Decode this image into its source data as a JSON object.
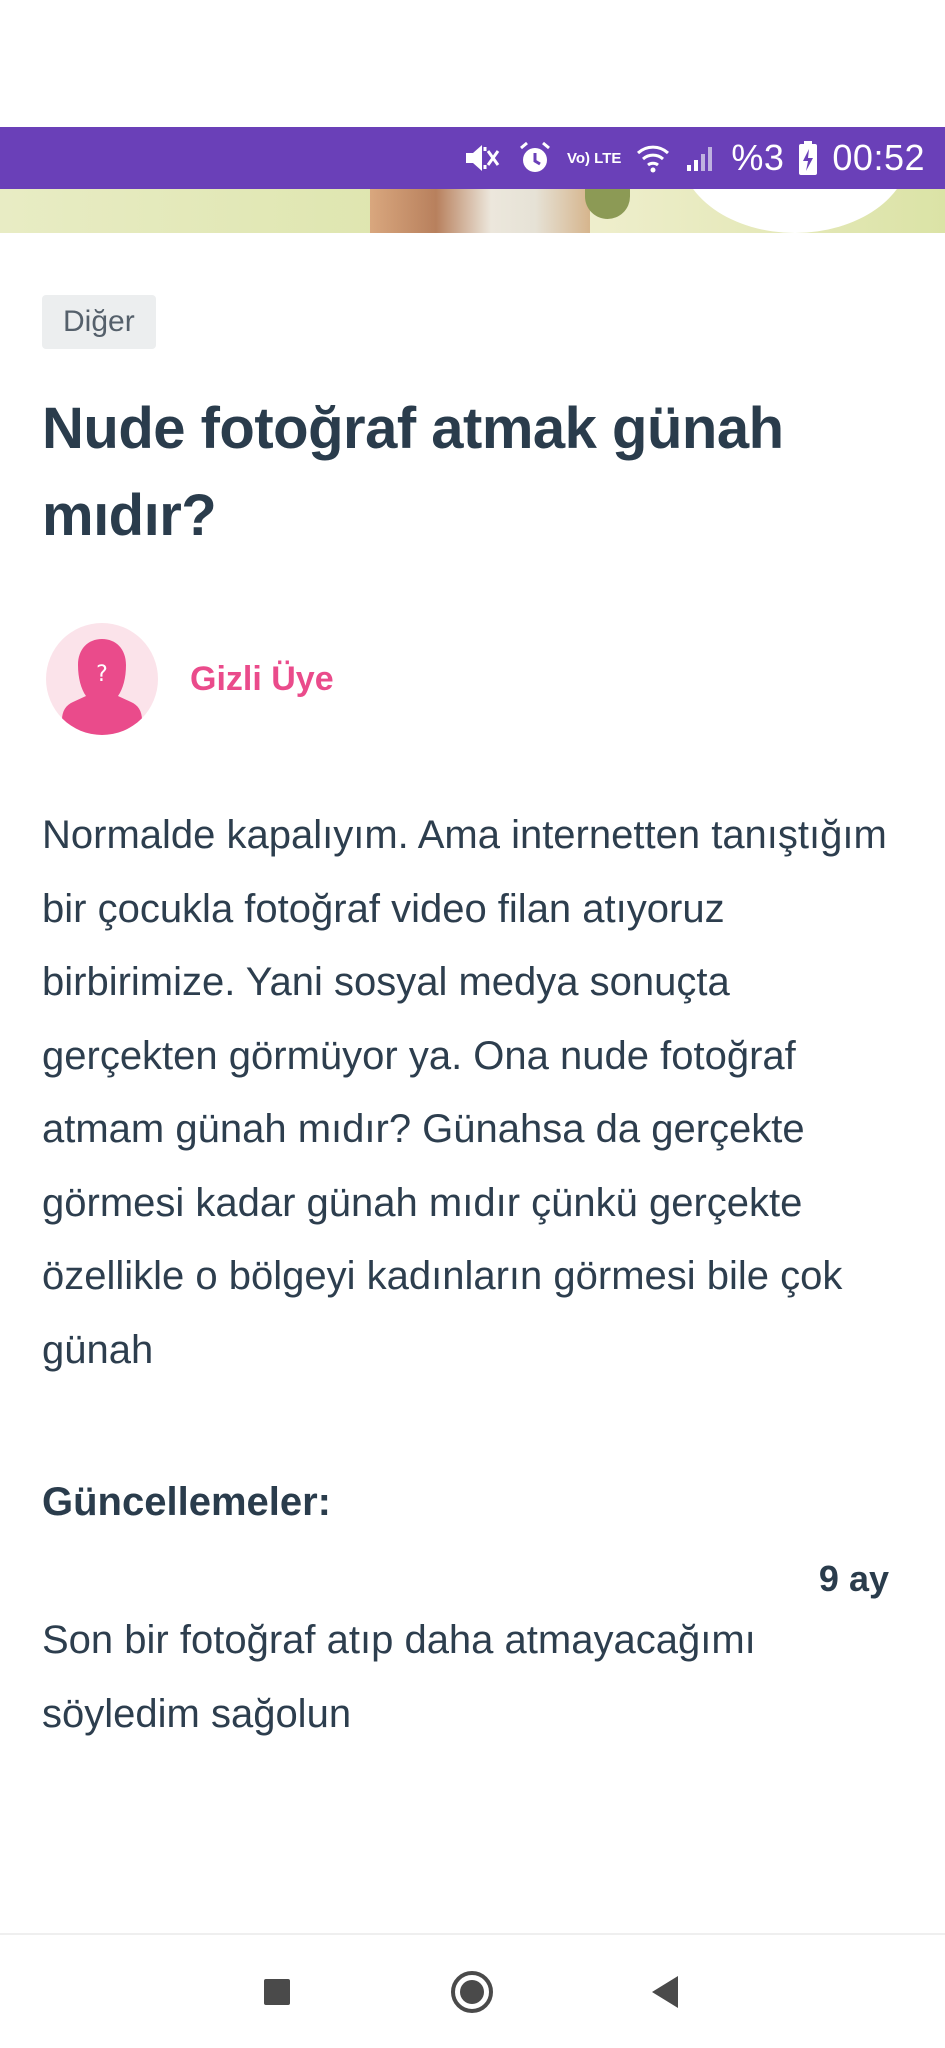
{
  "status_bar": {
    "lte_label": "Vo) LTE",
    "battery_text": "%3",
    "time": "00:52",
    "icons": [
      "mute-vibrate-icon",
      "alarm-icon",
      "volte-icon",
      "wifi-icon",
      "signal-icon",
      "battery-charging-icon"
    ]
  },
  "article": {
    "category": "Diğer",
    "title": "Nude fotoğraf atmak günah mıdır?",
    "author": "Gizli Üye",
    "body": "Normalde kapalıyım. Ama internetten tanıştığım bir çocukla fotoğraf video filan atıyoruz birbirimize. Yani sosyal medya sonuçta gerçekten görmüyor ya. Ona nude fotoğraf atmam günah mıdır? Günahsa da gerçekte görmesi kadar günah mıdır çünkü gerçekte özellikle o bölgeyi kadınların görmesi bile çok günah"
  },
  "updates": {
    "heading": "Güncellemeler:",
    "items": [
      {
        "time": "9 ay",
        "text": "Son bir fotoğraf atıp daha atmayacağımı söyledim sağolun"
      }
    ]
  },
  "colors": {
    "status_bar": "#6a40b8",
    "author_accent": "#ea4b8b",
    "text": "#2d3e4e",
    "category_bg": "#eceeef"
  },
  "nav": {
    "icons": [
      "recent-apps-icon",
      "home-icon",
      "back-icon"
    ]
  }
}
